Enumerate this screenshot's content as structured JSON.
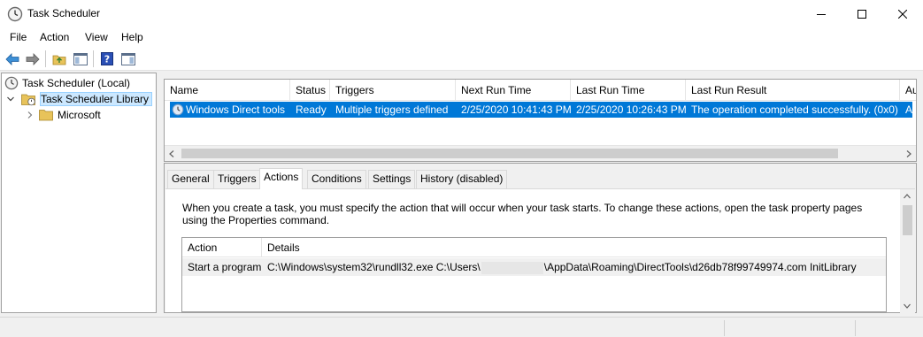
{
  "window": {
    "title": "Task Scheduler",
    "icons": {
      "app": "clock-icon",
      "minimize": "minimize-icon",
      "maximize": "maximize-icon",
      "close": "close-icon"
    }
  },
  "menu": [
    "File",
    "Action",
    "View",
    "Help"
  ],
  "toolbar": {
    "buttons": [
      "back-arrow-icon",
      "forward-arrow-icon",
      "up-folder-icon",
      "show-hide-tree-icon",
      "help-icon",
      "action-pane-icon"
    ]
  },
  "tree": {
    "root": "Task Scheduler (Local)",
    "library": "Task Scheduler Library",
    "child": "Microsoft"
  },
  "tasks": {
    "columns": [
      "Name",
      "Status",
      "Triggers",
      "Next Run Time",
      "Last Run Time",
      "Last Run Result",
      "Au"
    ],
    "rows": [
      {
        "name": "Windows Direct tools",
        "status": "Ready",
        "triggers": "Multiple triggers defined",
        "next_run": "2/25/2020 10:41:43 PM",
        "last_run": "2/25/2020 10:26:43 PM",
        "last_result": "The operation completed successfully. (0x0)",
        "author": "Au"
      }
    ]
  },
  "tabs": [
    "General",
    "Triggers",
    "Actions",
    "Conditions",
    "Settings",
    "History (disabled)"
  ],
  "active_tab": "Actions",
  "actions": {
    "description": "When you create a task, you must specify the action that will occur when your task starts.  To change these actions, open the task property pages using the Properties command.",
    "columns": [
      "Action",
      "Details"
    ],
    "rows": [
      {
        "action": "Start a program",
        "details_prefix": "C:\\Windows\\system32\\rundll32.exe C:\\Users\\",
        "details_suffix": "\\AppData\\Roaming\\DirectTools\\d26db78f99749974.com InitLibrary"
      }
    ]
  }
}
